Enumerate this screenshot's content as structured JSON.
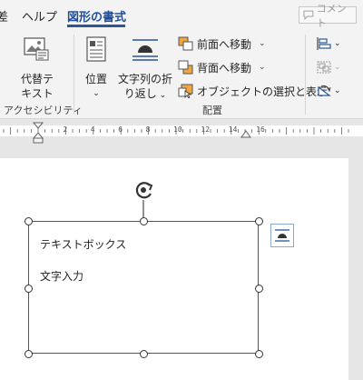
{
  "tabs": {
    "partial_left": "差",
    "help": "ヘルプ",
    "shape_format": "図形の書式",
    "comment": "コメント"
  },
  "ribbon": {
    "alt_text": "代替テキスト",
    "alt_text_line1": "代替テ",
    "alt_text_line2": "キスト",
    "accessibility_group": "アクセシビリティ",
    "position": "位置",
    "wrap_text_line1": "文字列の折",
    "wrap_text_line2": "り返し",
    "bring_forward": "前面へ移動",
    "send_backward": "背面へ移動",
    "selection_pane": "オブジェクトの選択と表示",
    "arrange_group": "配置"
  },
  "ruler": {
    "numbers": [
      "2",
      "4",
      "6",
      "8",
      "10",
      "12",
      "14",
      "16"
    ]
  },
  "document": {
    "textbox_line1": "テキストボックス",
    "textbox_line2": "文字入力"
  },
  "colors": {
    "accent": "#2b5797",
    "ribbon_bg": "#f3f3f3",
    "canvas_bg": "#e6e6e6",
    "page_bg": "#ffffff"
  },
  "icons": [
    "comment-icon",
    "alt-text-icon",
    "position-icon",
    "wrap-text-icon",
    "bring-forward-icon",
    "send-backward-icon",
    "selection-pane-icon",
    "align-icon",
    "group-icon",
    "rotate-icon",
    "rotation-handle-icon",
    "layout-options-icon"
  ]
}
